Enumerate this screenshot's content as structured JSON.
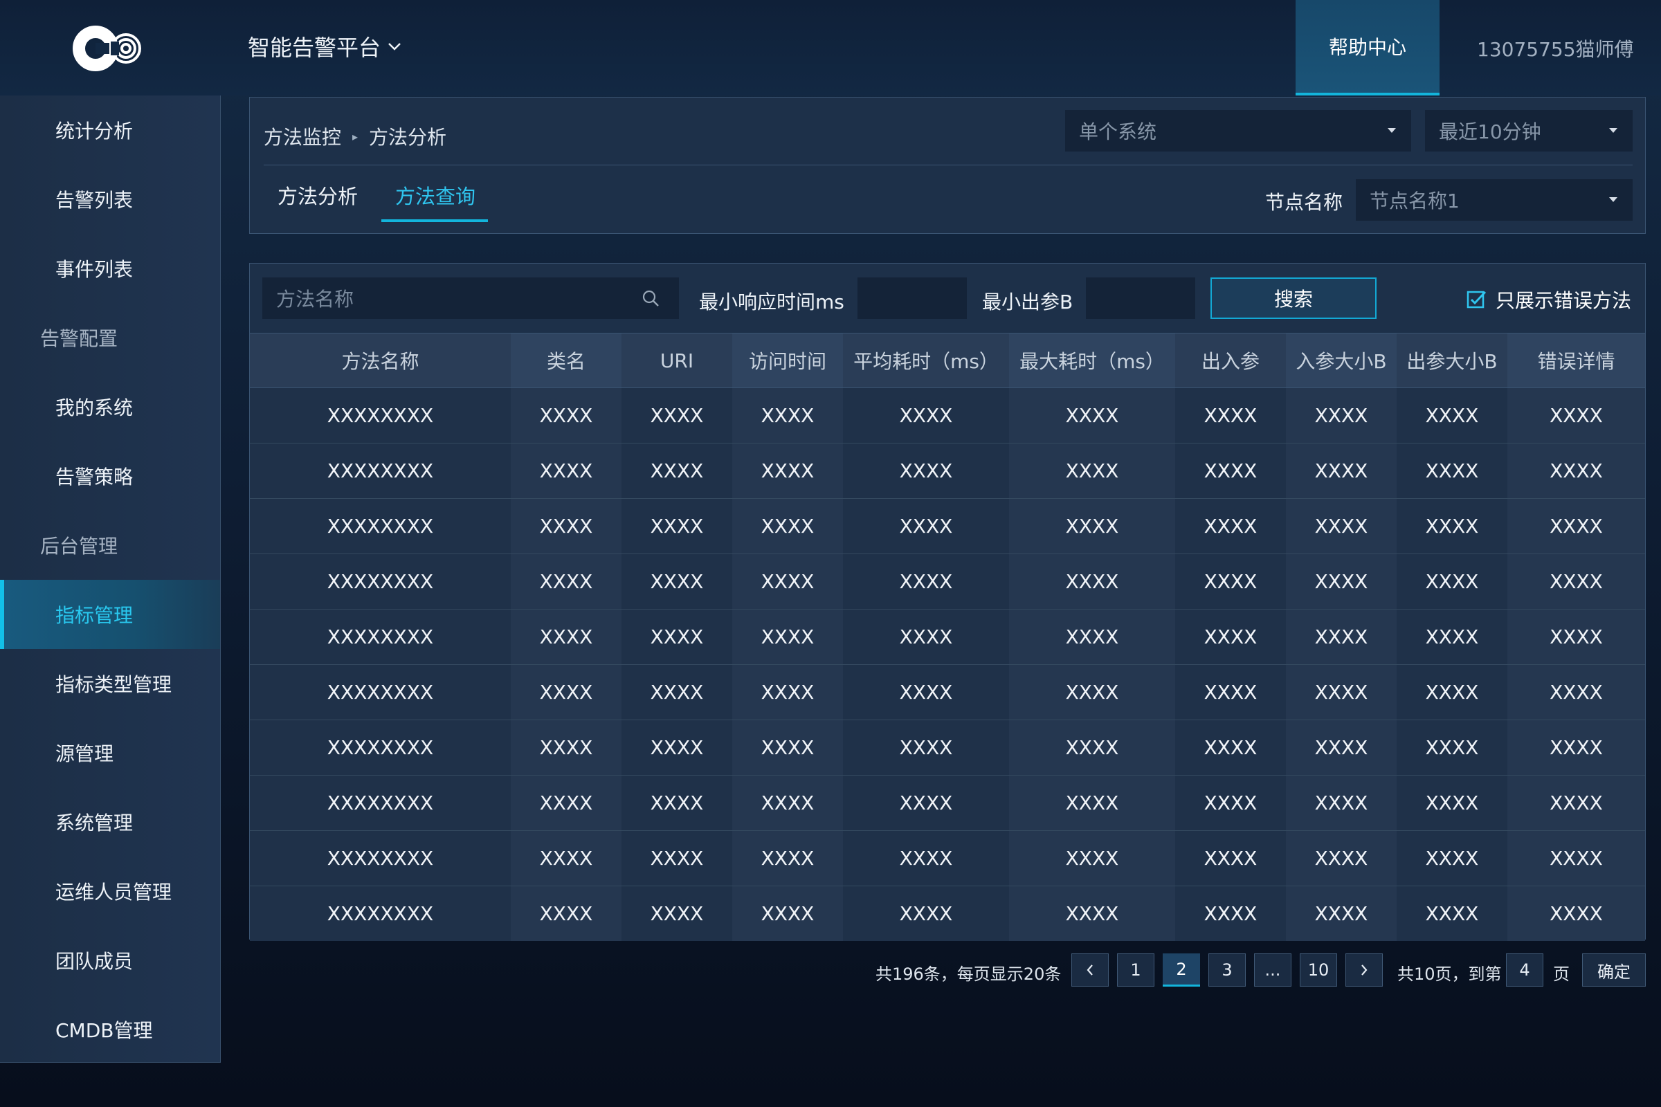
{
  "header": {
    "platform_name": "智能告警平台",
    "help_label": "帮助中心",
    "user_label": "13075755猫师傅"
  },
  "sidebar": {
    "items": [
      {
        "label": "统计分析",
        "type": "item"
      },
      {
        "label": "告警列表",
        "type": "item"
      },
      {
        "label": "事件列表",
        "type": "item"
      },
      {
        "label": "告警配置",
        "type": "group"
      },
      {
        "label": "我的系统",
        "type": "item"
      },
      {
        "label": "告警策略",
        "type": "item"
      },
      {
        "label": "后台管理",
        "type": "group"
      },
      {
        "label": "指标管理",
        "type": "item",
        "active": true
      },
      {
        "label": "指标类型管理",
        "type": "item"
      },
      {
        "label": "源管理",
        "type": "item"
      },
      {
        "label": "系统管理",
        "type": "item"
      },
      {
        "label": "运维人员管理",
        "type": "item"
      },
      {
        "label": "团队成员",
        "type": "item"
      },
      {
        "label": "CMDB管理",
        "type": "item"
      }
    ]
  },
  "breadcrumb": {
    "root": "方法监控",
    "current": "方法分析"
  },
  "filters": {
    "system_select": "单个系统",
    "time_select": "最近10分钟",
    "node_label": "节点名称",
    "node_select": "节点名称1"
  },
  "tabs": [
    {
      "label": "方法分析",
      "active": false
    },
    {
      "label": "方法查询",
      "active": true
    }
  ],
  "search": {
    "placeholder": "方法名称",
    "min_response_label": "最小响应时间ms",
    "min_response_value": "",
    "min_out_label": "最小出参B",
    "min_out_value": "",
    "button_label": "搜索",
    "only_errors_label": "只展示错误方法",
    "only_errors_checked": true
  },
  "table": {
    "columns": [
      "方法名称",
      "类名",
      "URI",
      "访问时间",
      "平均耗时（ms）",
      "最大耗时（ms）",
      "出入参",
      "入参大小B",
      "出参大小B",
      "错误详情"
    ],
    "rows": [
      [
        "XXXXXXXX",
        "XXXX",
        "XXXX",
        "XXXX",
        "XXXX",
        "XXXX",
        "XXXX",
        "XXXX",
        "XXXX",
        "XXXX"
      ],
      [
        "XXXXXXXX",
        "XXXX",
        "XXXX",
        "XXXX",
        "XXXX",
        "XXXX",
        "XXXX",
        "XXXX",
        "XXXX",
        "XXXX"
      ],
      [
        "XXXXXXXX",
        "XXXX",
        "XXXX",
        "XXXX",
        "XXXX",
        "XXXX",
        "XXXX",
        "XXXX",
        "XXXX",
        "XXXX"
      ],
      [
        "XXXXXXXX",
        "XXXX",
        "XXXX",
        "XXXX",
        "XXXX",
        "XXXX",
        "XXXX",
        "XXXX",
        "XXXX",
        "XXXX"
      ],
      [
        "XXXXXXXX",
        "XXXX",
        "XXXX",
        "XXXX",
        "XXXX",
        "XXXX",
        "XXXX",
        "XXXX",
        "XXXX",
        "XXXX"
      ],
      [
        "XXXXXXXX",
        "XXXX",
        "XXXX",
        "XXXX",
        "XXXX",
        "XXXX",
        "XXXX",
        "XXXX",
        "XXXX",
        "XXXX"
      ],
      [
        "XXXXXXXX",
        "XXXX",
        "XXXX",
        "XXXX",
        "XXXX",
        "XXXX",
        "XXXX",
        "XXXX",
        "XXXX",
        "XXXX"
      ],
      [
        "XXXXXXXX",
        "XXXX",
        "XXXX",
        "XXXX",
        "XXXX",
        "XXXX",
        "XXXX",
        "XXXX",
        "XXXX",
        "XXXX"
      ],
      [
        "XXXXXXXX",
        "XXXX",
        "XXXX",
        "XXXX",
        "XXXX",
        "XXXX",
        "XXXX",
        "XXXX",
        "XXXX",
        "XXXX"
      ],
      [
        "XXXXXXXX",
        "XXXX",
        "XXXX",
        "XXXX",
        "XXXX",
        "XXXX",
        "XXXX",
        "XXXX",
        "XXXX",
        "XXXX"
      ]
    ]
  },
  "pagination": {
    "summary": "共196条，每页显示20条",
    "prev_icon": "chevron-left-icon",
    "next_icon": "chevron-right-icon",
    "pages": [
      "1",
      "2",
      "3",
      "...",
      "10"
    ],
    "current_page": "2",
    "total_pages_label": "共10页，到第",
    "goto_value": "4",
    "page_suffix": "页",
    "confirm_label": "确定"
  },
  "colors": {
    "accent": "#13b5dc",
    "active_text": "#2fc5ef",
    "panel": "#1d3049",
    "input": "#142338"
  }
}
